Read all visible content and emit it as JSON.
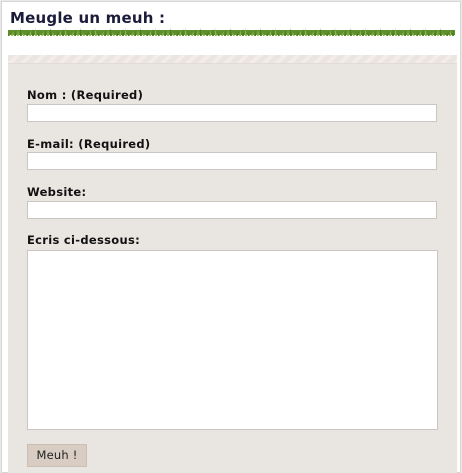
{
  "header": {
    "title": "Meugle un meuh :"
  },
  "form": {
    "name_label": "Nom : (Required)",
    "email_label": "E-mail: (Required)",
    "website_label": "Website:",
    "comment_label": "Ecris ci-dessous:",
    "name_value": "",
    "email_value": "",
    "website_value": "",
    "comment_value": "",
    "submit_label": "Meuh !"
  },
  "colors": {
    "panel_bg": "#e9e5e1",
    "button_bg": "#d9cdc3",
    "title_color": "#1b1b3a",
    "grass_dark": "#4f7d23",
    "grass_light": "#8bb84a"
  }
}
